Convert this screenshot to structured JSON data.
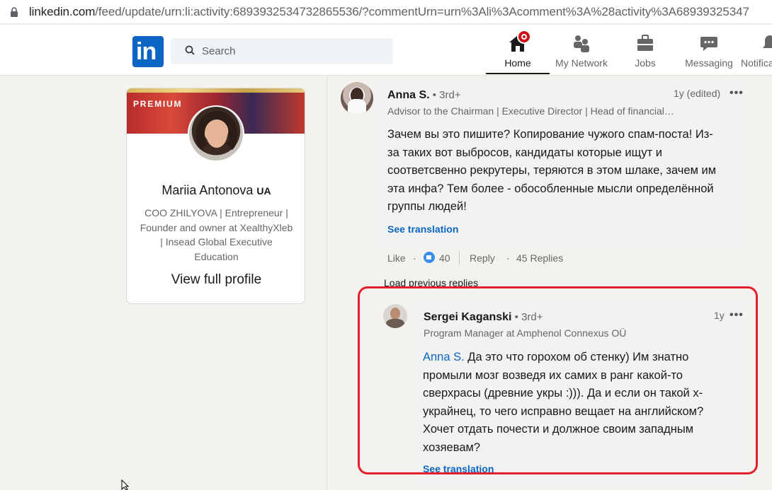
{
  "browser": {
    "url_host": "linkedin.com",
    "url_path": "/feed/update/urn:li:activity:6893932534732865536/?commentUrn=urn%3Ali%3Acomment%3A%28activity%3A68939325347"
  },
  "nav": {
    "search_placeholder": "Search",
    "items": [
      {
        "label": "Home"
      },
      {
        "label": "My Network"
      },
      {
        "label": "Jobs"
      },
      {
        "label": "Messaging"
      },
      {
        "label": "Notifications"
      }
    ]
  },
  "profile": {
    "badge": "PREMIUM",
    "name": "Mariia Antonova",
    "country": "UA",
    "headline": "COO ZHILYOVA | Entrepreneur | Founder and owner at XealthyXleb | Insead Global Executive Education",
    "view_profile": "View full profile"
  },
  "comments": [
    {
      "author": "Anna S.",
      "degree": " • 3rd+",
      "title": "Advisor to the Chairman | Executive Director | Head of financial…",
      "time": "1y (edited)",
      "body": "Зачем вы это пишите? Копирование чужого спам-поста! Из-за таких вот выбросов, кандидаты которые ищут и соответсвенно рекрутеры, теряются в этом шлаке, зачем им эта инфа? Тем более - обособленные мысли определённой группы людей!",
      "see_translation": "See translation",
      "actions": {
        "like": "Like",
        "like_count": "40",
        "reply": "Reply",
        "replies": "45 Replies"
      }
    },
    {
      "author": "Sergei Kaganski",
      "degree": " • 3rd+",
      "title": "Program Manager at Amphenol Connexus OÜ",
      "time": "1y",
      "mention": "Anna S.",
      "body": " Да это что горохом об стенку) Им знатно промыли мозг возведя их самих в ранг какой-то сверхрасы (древние укры :))). Да и если он такой х-украйнец, то чего исправно вещает на английском? Хочет отдать почести и должное своим западным хозяевам?",
      "see_translation": "See translation"
    }
  ],
  "load_previous": "Load previous replies",
  "separator_dot": "·",
  "more_dots": "•••",
  "highlight_color": "#e41e2c",
  "accent_color": "#0a66c2"
}
